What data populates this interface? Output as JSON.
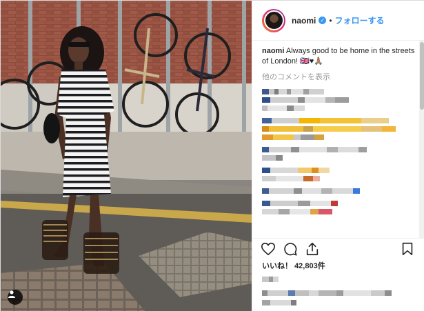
{
  "header": {
    "username": "naomi",
    "verified_glyph": "✓",
    "separator": "•",
    "follow_label": "フォローする"
  },
  "caption": {
    "username": "naomi",
    "text": "Always good to be home in the streets of London! 🇬🇧♥🙏🏽"
  },
  "more_comments_label": "他のコメントを表示",
  "actions": {
    "like_icon": "heart-icon",
    "comment_icon": "comment-icon",
    "share_icon": "share-icon",
    "save_icon": "bookmark-icon"
  },
  "likes": {
    "label": "いいね！",
    "count": "42,803件"
  },
  "colors": {
    "accent": "#3897f0",
    "text": "#262626",
    "muted": "#999999",
    "border": "#efefef"
  }
}
